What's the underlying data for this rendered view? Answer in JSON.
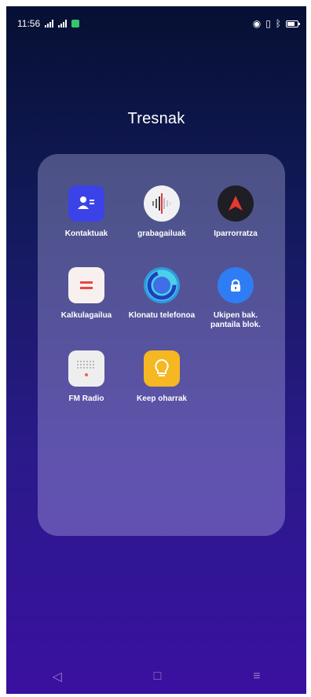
{
  "status_bar": {
    "time": "11:56",
    "icons": [
      "signal-icon",
      "signal-icon",
      "app-notification-icon",
      "nfc-icon",
      "vibrate-icon",
      "bluetooth-icon",
      "battery-icon"
    ]
  },
  "folder": {
    "title": "Tresnak",
    "apps": [
      {
        "label": "Kontaktuak",
        "icon": "contacts-icon",
        "color": "#3b43e8"
      },
      {
        "label": "grabagailuak",
        "icon": "voice-recorder-icon",
        "color": "#f1f1f4"
      },
      {
        "label": "Iparrorratza",
        "icon": "compass-icon",
        "color": "#1e1e24"
      },
      {
        "label": "Kalkulagailua",
        "icon": "calculator-icon",
        "color": "#f7f0ee"
      },
      {
        "label": "Klonatu telefonoa",
        "icon": "clone-phone-icon",
        "color": "#4ad0e8"
      },
      {
        "label": "Ukipen bak. pantaila blok.",
        "icon": "screen-lock-icon",
        "color": "#2f7df4"
      },
      {
        "label": "FM Radio",
        "icon": "fm-radio-icon",
        "color": "#eeeeee"
      },
      {
        "label": "Keep oharrak",
        "icon": "notes-lightbulb-icon",
        "color": "#f5b722"
      }
    ]
  },
  "nav_bar": {
    "back": "◁",
    "home": "□",
    "menu": "≡"
  }
}
